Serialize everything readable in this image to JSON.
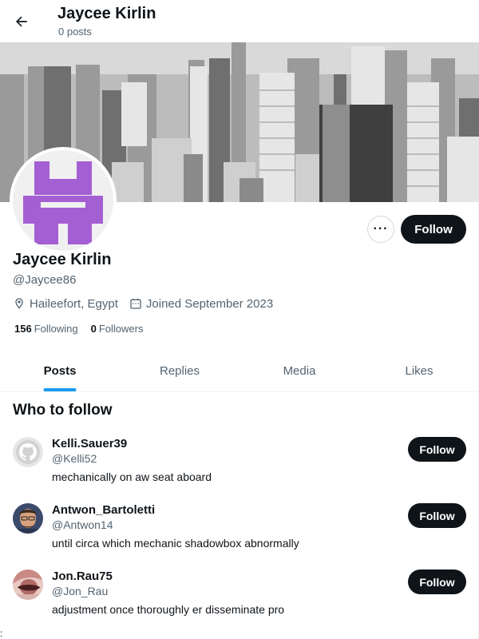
{
  "header": {
    "title": "Jaycee Kirlin",
    "subtitle": "0 posts"
  },
  "profile": {
    "display_name": "Jaycee Kirlin",
    "handle": "@Jaycee86",
    "location": "Haileefort, Egypt",
    "joined": "Joined September 2023",
    "following_count": "156",
    "following_label": "Following",
    "followers_count": "0",
    "followers_label": "Followers",
    "more_label": "···",
    "follow_label": "Follow",
    "avatar_color": "#a45fd3"
  },
  "tabs": [
    {
      "label": "Posts",
      "active": true
    },
    {
      "label": "Replies",
      "active": false
    },
    {
      "label": "Media",
      "active": false
    },
    {
      "label": "Likes",
      "active": false
    }
  ],
  "who_to_follow": {
    "title": "Who to follow",
    "items": [
      {
        "name": "Kelli.Sauer39",
        "handle": "@Kelli52",
        "bio": "mechanically on aw seat aboard",
        "follow_label": "Follow"
      },
      {
        "name": "Antwon_Bartoletti",
        "handle": "@Antwon14",
        "bio": "until circa which mechanic shadowbox abnormally",
        "follow_label": "Follow"
      },
      {
        "name": "Jon.Rau75",
        "handle": "@Jon_Rau",
        "bio": "adjustment once thoroughly er disseminate pro",
        "follow_label": "Follow"
      }
    ]
  },
  "stray_text": ":",
  "colors": {
    "accent": "#1d9bf0",
    "button_dark": "#0f1419",
    "secondary_text": "#536471"
  }
}
